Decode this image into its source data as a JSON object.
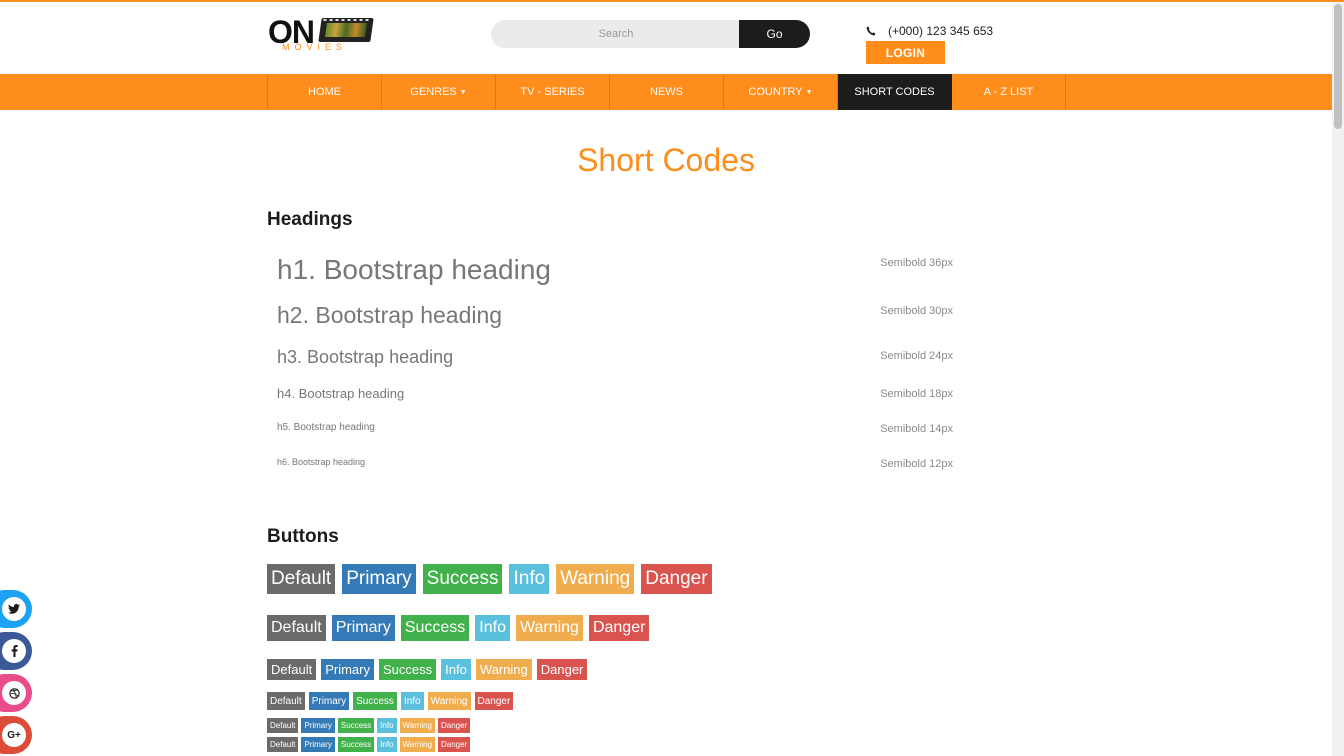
{
  "header": {
    "logo_main": "ON",
    "logo_sub": "MOVIES",
    "search_placeholder": "Search",
    "go_label": "Go",
    "phone": "(+000) 123 345 653",
    "login_label": "LOGIN"
  },
  "nav": {
    "items": [
      {
        "label": "HOME"
      },
      {
        "label": "GENRES"
      },
      {
        "label": "TV - SERIES"
      },
      {
        "label": "NEWS"
      },
      {
        "label": "COUNTRY"
      },
      {
        "label": "SHORT CODES"
      },
      {
        "label": "A - Z LIST"
      }
    ]
  },
  "page": {
    "title": "Short Codes",
    "headings_title": "Headings",
    "buttons_title": "Buttons"
  },
  "headings": [
    {
      "text": "h1. Bootstrap heading",
      "note": "Semibold 36px"
    },
    {
      "text": "h2. Bootstrap heading",
      "note": "Semibold 30px"
    },
    {
      "text": "h3. Bootstrap heading",
      "note": "Semibold 24px"
    },
    {
      "text": "h4. Bootstrap heading",
      "note": "Semibold 18px"
    },
    {
      "text": "h5. Bootstrap heading",
      "note": "Semibold 14px"
    },
    {
      "text": "h6. Bootstrap heading",
      "note": "Semibold 12px"
    }
  ],
  "buttons": {
    "labels": [
      "Default",
      "Primary",
      "Success",
      "Info",
      "Warning",
      "Danger"
    ]
  },
  "colors": {
    "accent": "#ff8d1b",
    "dark": "#1c1c1c",
    "default": "#6a6a6a",
    "primary": "#337ab7",
    "success": "#41b14b",
    "info": "#5bc0de",
    "warning": "#f0ad4e",
    "danger": "#d9534f",
    "twitter": "#1da1f2",
    "facebook": "#3b5998",
    "dribbble": "#ea4c89",
    "google_plus": "#dd4b39"
  },
  "social": {
    "icons": [
      "twitter-icon",
      "facebook-icon",
      "dribbble-icon",
      "google-plus-icon"
    ]
  }
}
